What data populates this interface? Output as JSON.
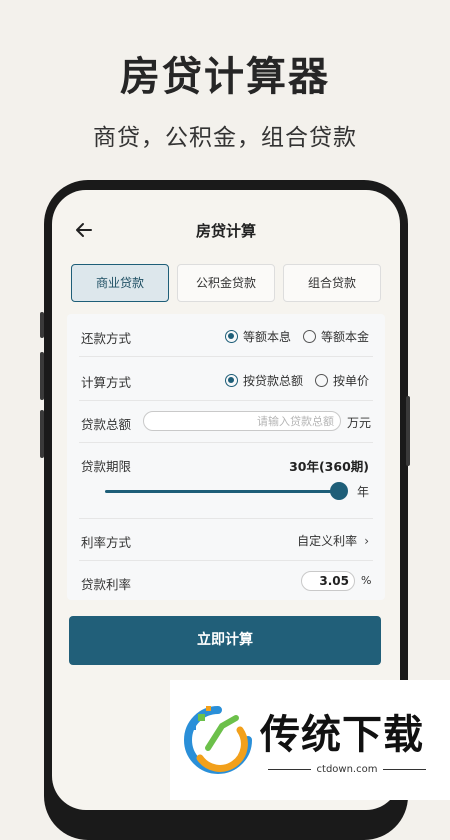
{
  "promo": {
    "title": "房贷计算器",
    "subtitle": "商贷，公积金，组合贷款"
  },
  "nav": {
    "back_icon": "arrow-left-icon",
    "title": "房贷计算"
  },
  "tabs": [
    {
      "label": "商业贷款",
      "active": true
    },
    {
      "label": "公积金贷款",
      "active": false
    },
    {
      "label": "组合贷款",
      "active": false
    }
  ],
  "form": {
    "repayment": {
      "label": "还款方式",
      "options": [
        {
          "label": "等额本息",
          "selected": true
        },
        {
          "label": "等额本金",
          "selected": false
        }
      ]
    },
    "calc_method": {
      "label": "计算方式",
      "options": [
        {
          "label": "按贷款总额",
          "selected": true
        },
        {
          "label": "按单价",
          "selected": false
        }
      ]
    },
    "amount": {
      "label": "贷款总额",
      "value": "",
      "placeholder": "请输入贷款总额",
      "unit": "万元"
    },
    "term": {
      "label": "贷款期限",
      "value": "30年(360期)",
      "unit": "年",
      "slider_fraction": 1.0
    },
    "rate_mode": {
      "label": "利率方式",
      "value": "自定义利率",
      "chevron": "›"
    },
    "rate": {
      "label": "贷款利率",
      "value": "3.05",
      "unit": "%"
    }
  },
  "submit_label": "立即计算",
  "watermark": {
    "text": "传统下载",
    "url": "ctdown.com"
  },
  "colors": {
    "accent": "#215f79",
    "tab_active_bg": "#dde7ec",
    "page_bg": "#f3f1ec"
  }
}
